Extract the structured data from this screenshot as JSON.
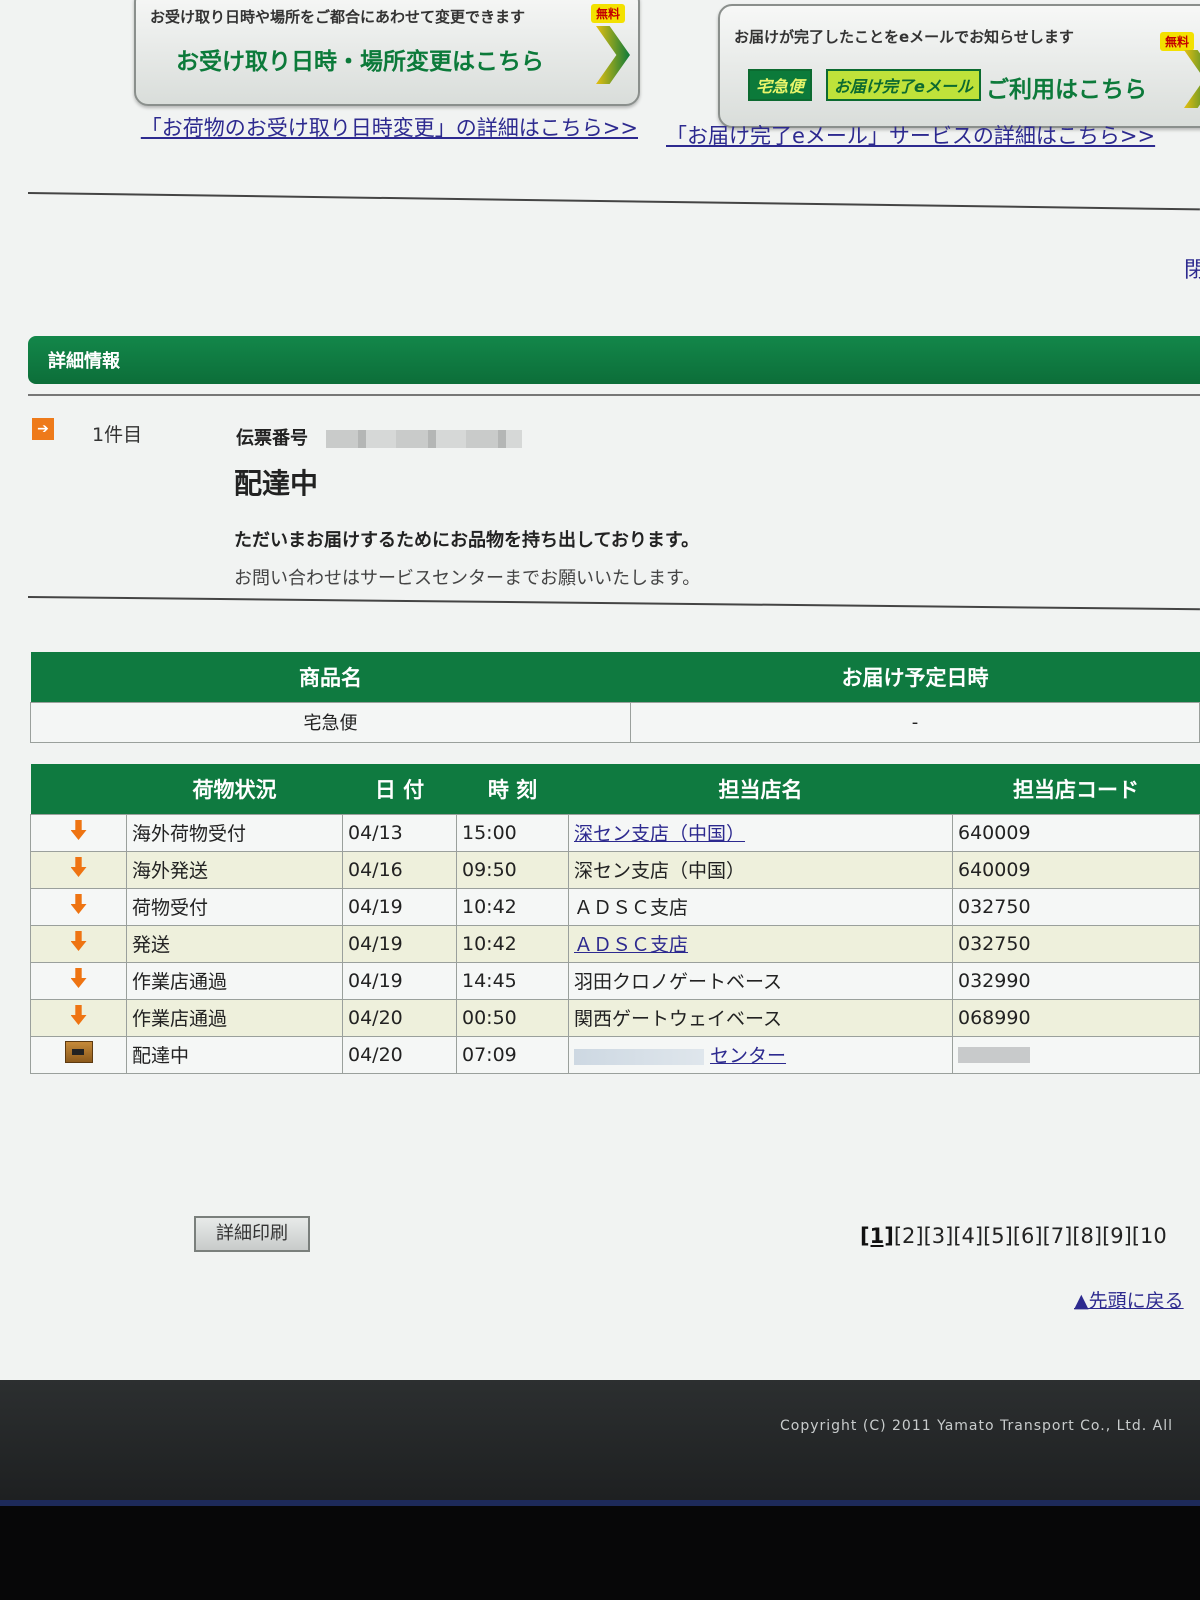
{
  "banners": [
    {
      "note": "お受け取り日時や場所をご都合にあわせて変更できます",
      "free": "無料",
      "main": "お受け取り日時・場所変更はこちら",
      "link": "「お荷物のお受け取り日時変更」の詳細はこちら>>"
    },
    {
      "note": "お届けが完了したことをeメールでお知らせします",
      "free": "無料",
      "pill_a": "宅急便",
      "pill_b": "お届け完了eメール",
      "main": "ご利用はこちら",
      "link": "「お届け完了eメール」サービスの詳細はこちら>>"
    }
  ],
  "close_glyph": "閉",
  "section_title": "詳細情報",
  "item": {
    "badge": "➔",
    "index_label": "1件目",
    "slip_label": "伝票番号",
    "status": "配達中",
    "description": "ただいまお届けするためにお品物を持ち出しております。",
    "note": "お問い合わせはサービスセンターまでお願いいたします。"
  },
  "product": {
    "headers": [
      "商品名",
      "お届け予定日時"
    ],
    "values": [
      "宅急便",
      "-"
    ]
  },
  "history": {
    "headers": [
      "荷物状況",
      "日 付",
      "時 刻",
      "担当店名",
      "担当店コード"
    ],
    "rows": [
      {
        "icon": "down-arrow",
        "status": "海外荷物受付",
        "date": "04/13",
        "time": "15:00",
        "store": "深セン支店（中国）",
        "store_link": true,
        "code": "640009"
      },
      {
        "icon": "down-arrow",
        "status": "海外発送",
        "date": "04/16",
        "time": "09:50",
        "store": "深セン支店（中国）",
        "store_link": false,
        "code": "640009"
      },
      {
        "icon": "down-arrow",
        "status": "荷物受付",
        "date": "04/19",
        "time": "10:42",
        "store": "ＡＤＳＣ支店",
        "store_link": false,
        "code": "032750"
      },
      {
        "icon": "down-arrow",
        "status": "発送",
        "date": "04/19",
        "time": "10:42",
        "store": "ＡＤＳＣ支店",
        "store_link": true,
        "code": "032750"
      },
      {
        "icon": "down-arrow",
        "status": "作業店通過",
        "date": "04/19",
        "time": "14:45",
        "store": "羽田クロノゲートベース",
        "store_link": false,
        "code": "032990"
      },
      {
        "icon": "down-arrow",
        "status": "作業店通過",
        "date": "04/20",
        "time": "00:50",
        "store": "関西ゲートウェイベース",
        "store_link": false,
        "code": "068990"
      },
      {
        "icon": "box",
        "status": "配達中",
        "date": "04/20",
        "time": "07:09",
        "store": "センター",
        "store_link": true,
        "masked_store": true,
        "code": "",
        "masked_code": true
      }
    ]
  },
  "print_button": "詳細印刷",
  "pager": {
    "current": "[1]",
    "pages": [
      "[2]",
      "[3]",
      "[4]",
      "[5]",
      "[6]",
      "[7]",
      "[8]",
      "[9]",
      "[10"
    ]
  },
  "to_top": "▲先頭に戻る",
  "footer": {
    "copyright": "Copyright (C) 2011 Yamato Transport Co., Ltd. All"
  }
}
